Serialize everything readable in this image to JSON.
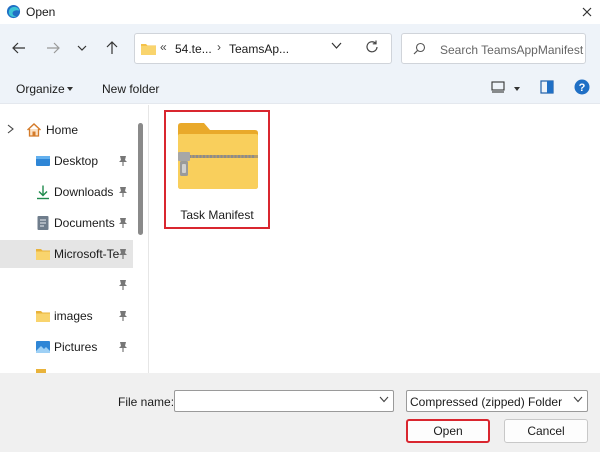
{
  "window": {
    "title": "Open"
  },
  "address_bar": {
    "overflow": "«",
    "segments": [
      "54.te...",
      "TeamsAp..."
    ]
  },
  "search": {
    "placeholder": "Search TeamsAppManifest"
  },
  "commands": {
    "organize": "Organize",
    "new_folder": "New folder"
  },
  "nav_pane": {
    "items": [
      {
        "label": "Home",
        "icon": "home-icon",
        "pinned": false
      },
      {
        "label": "Desktop",
        "icon": "desktop-icon",
        "pinned": true
      },
      {
        "label": "Downloads",
        "icon": "download-icon",
        "pinned": true
      },
      {
        "label": "Documents",
        "icon": "documents-icon",
        "pinned": true
      },
      {
        "label": "Microsoft-Te",
        "icon": "folder-icon",
        "pinned": true,
        "selected": true
      },
      {
        "label": "",
        "icon": "",
        "pinned": true
      },
      {
        "label": "images",
        "icon": "folder-icon",
        "pinned": true
      },
      {
        "label": "Pictures",
        "icon": "pictures-icon",
        "pinned": true
      }
    ]
  },
  "files": [
    {
      "name": "Task Manifest",
      "icon": "zip-folder-icon",
      "selected": true
    }
  ],
  "footer": {
    "file_name_label": "File name:",
    "file_name_value": "",
    "file_type": "Compressed (zipped) Folder",
    "open_label": "Open",
    "cancel_label": "Cancel"
  },
  "colors": {
    "highlight": "#d9262f",
    "nav_bg": "#eef3f9",
    "folder": "#f7c948"
  }
}
